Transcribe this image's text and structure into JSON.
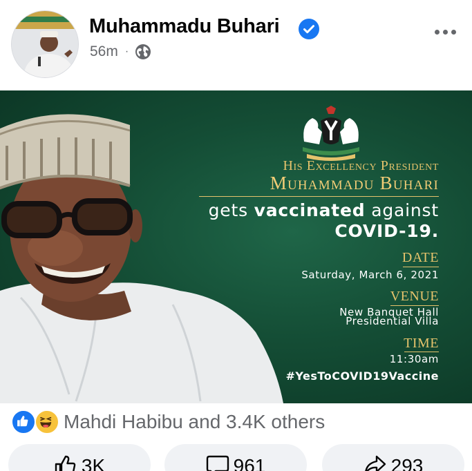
{
  "post": {
    "author": "Muhammadu Buhari",
    "time_ago": "56m",
    "separator": "·",
    "audience_icon": "globe-icon",
    "verified_icon": "verified-badge-icon",
    "more_icon": "more-options-icon"
  },
  "flyer": {
    "title_line_1": "His Excellency President",
    "title_line_2": "Muhammadu Buhari",
    "headline_prefix": "gets ",
    "headline_bold": "vaccinated",
    "headline_suffix": " against",
    "headline_line_2": "COVID-19.",
    "date_label": "DATE",
    "date_value": "Saturday, March 6, 2021",
    "venue_label": "VENUE",
    "venue_line_1": "New Banquet Hall",
    "venue_line_2": "Presidential Villa",
    "time_label": "TIME",
    "time_value": "11:30am",
    "hashtag": "#YesToCOVID19Vaccine"
  },
  "reactions": {
    "icons": [
      "like-reaction-icon",
      "haha-reaction-icon"
    ],
    "summary": "Mahdi Habibu and 3.4K others"
  },
  "actions": {
    "like_count": "3K",
    "comment_count": "961",
    "share_count": "293"
  },
  "colors": {
    "brand_blue": "#1877f2",
    "flyer_green": "#144d35",
    "flyer_gold": "#e5c36c",
    "secondary_text": "#65676b"
  }
}
